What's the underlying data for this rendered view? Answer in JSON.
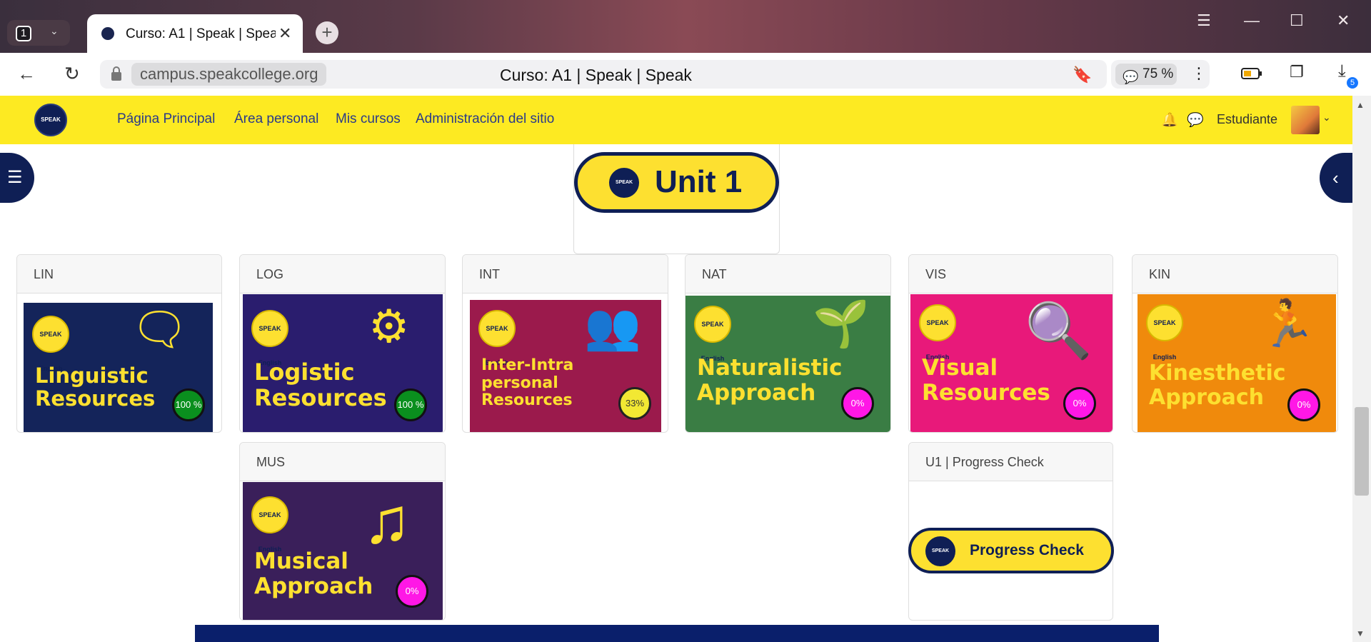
{
  "browser": {
    "tab_count": "1",
    "tab_title": "Curso: A1 | Speak | Speak",
    "url": "campus.speakcollege.org",
    "page_title": "Curso: A1 | Speak | Speak",
    "zoom": "75 %",
    "downloads_badge": "5"
  },
  "site": {
    "logo_text": "SPEAK",
    "nav": [
      "Página Principal",
      "Área personal",
      "Mis cursos",
      "Administración del sitio"
    ],
    "user_name": "Estudiante"
  },
  "unit_banner": {
    "label": "Unit 1",
    "seal": "SPEAK"
  },
  "activities": [
    {
      "code": "LIN",
      "title": "Linguistic Resources",
      "progress": "100 %",
      "progress_pct": 100,
      "color": "#14245a"
    },
    {
      "code": "LOG",
      "title": "Logistic Resources",
      "progress": "100 %",
      "progress_pct": 100,
      "color": "#2a1d6e"
    },
    {
      "code": "INT",
      "title": "Inter-Intra personal Resources",
      "progress": "33%",
      "progress_pct": 33,
      "color": "#9b1a4c"
    },
    {
      "code": "NAT",
      "title": "Naturalistic Approach",
      "progress": "0%",
      "progress_pct": 0,
      "color": "#3a7d44"
    },
    {
      "code": "VIS",
      "title": "Visual Resources",
      "progress": "0%",
      "progress_pct": 0,
      "color": "#e8197a"
    },
    {
      "code": "KIN",
      "title": "Kinesthetic Approach",
      "progress": "0%",
      "progress_pct": 0,
      "color": "#f08a0c"
    },
    {
      "code": "MUS",
      "title": "Musical Approach",
      "progress": "0%",
      "progress_pct": 0,
      "color": "#3a1f5a"
    }
  ],
  "progress_check": {
    "header": "U1 | Progress Check",
    "label": "Progress Check",
    "seal": "SPEAK"
  },
  "badge_text": "SPEAK English"
}
